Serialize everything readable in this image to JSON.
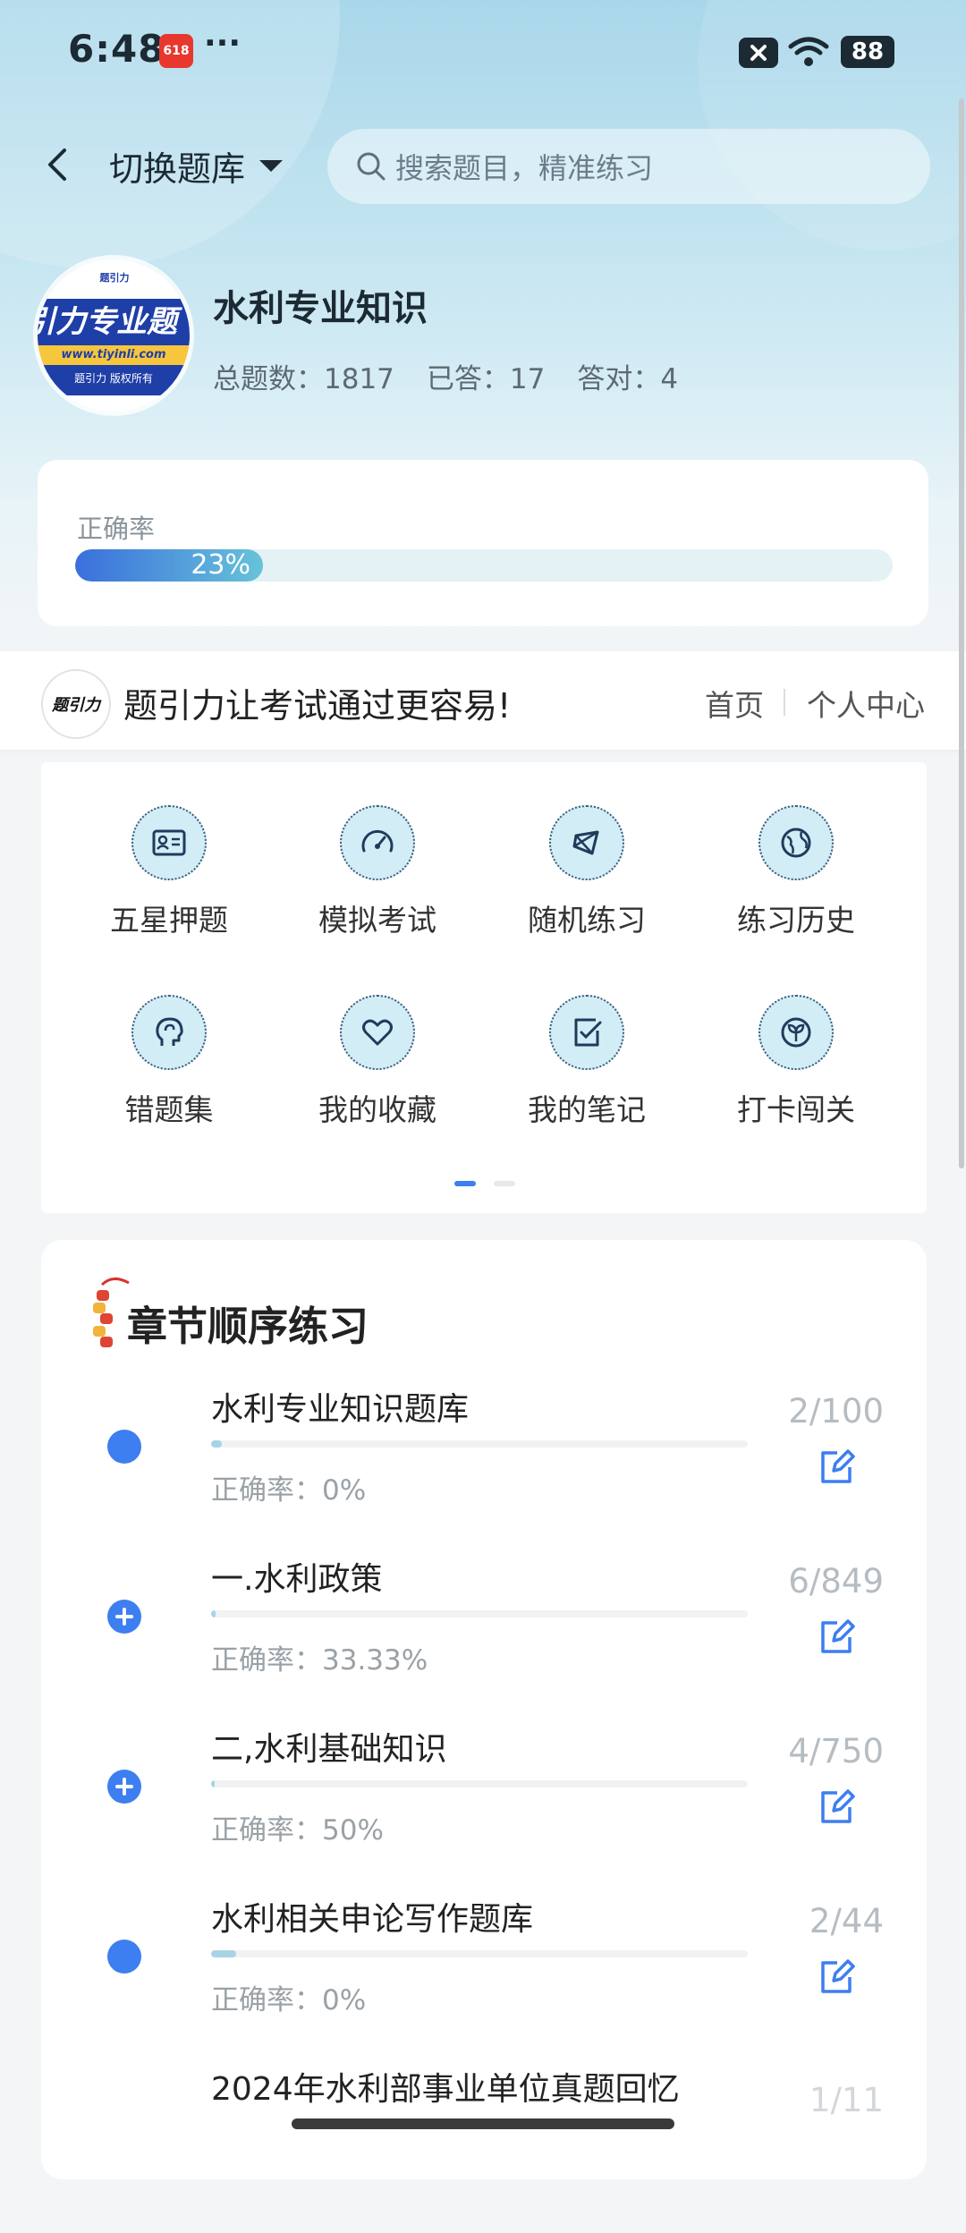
{
  "status_bar": {
    "time": "6:48",
    "app_badge": "618",
    "more": "···",
    "battery": "88"
  },
  "header": {
    "switch_label": "切换题库",
    "search_placeholder": "搜索题目，精准练习"
  },
  "bank": {
    "logo_title": "引力专业题",
    "logo_url": "www.tiyinli.com",
    "logo_footer": "题引力 版权所有",
    "logo_mini": "题引力",
    "title": "水利专业知识",
    "stats": [
      {
        "label": "总题数：",
        "value": "1817"
      },
      {
        "label": "已答：",
        "value": "17"
      },
      {
        "label": "答对：",
        "value": "4"
      }
    ]
  },
  "accuracy": {
    "label": "正确率",
    "value_text": "23%",
    "fraction": 0.23
  },
  "banner": {
    "logo_text": "题引力",
    "slogan": "题引力让考试通过更容易!",
    "home": "首页",
    "me": "个人中心"
  },
  "features": [
    {
      "label": "五星押题",
      "icon": "id-card-icon"
    },
    {
      "label": "模拟考试",
      "icon": "speedometer-icon"
    },
    {
      "label": "随机练习",
      "icon": "shuffle-icon"
    },
    {
      "label": "练习历史",
      "icon": "globe-history-icon"
    },
    {
      "label": "错题集",
      "icon": "brain-head-icon"
    },
    {
      "label": "我的收藏",
      "icon": "heart-icon"
    },
    {
      "label": "我的笔记",
      "icon": "note-check-icon"
    },
    {
      "label": "打卡闯关",
      "icon": "leaf-shield-icon"
    }
  ],
  "pager": {
    "pages": 2,
    "active": 0
  },
  "chapters": {
    "title": "章节顺序练习",
    "rows": [
      {
        "name": "水利专业知识题库",
        "accuracy_label": "正确率：",
        "accuracy": "0%",
        "count": "2/100",
        "expandable": false,
        "progress": 0.02
      },
      {
        "name": "一.水利政策",
        "accuracy_label": "正确率：",
        "accuracy": "33.33%",
        "count": "6/849",
        "expandable": true,
        "progress": 0.007
      },
      {
        "name": "二,水利基础知识",
        "accuracy_label": "正确率：",
        "accuracy": "50%",
        "count": "4/750",
        "expandable": true,
        "progress": 0.005
      },
      {
        "name": "水利相关申论写作题库",
        "accuracy_label": "正确率：",
        "accuracy": "0%",
        "count": "2/44",
        "expandable": false,
        "progress": 0.045
      },
      {
        "name": "2024年水利部事业单位真题回忆",
        "accuracy_label": "",
        "accuracy": "",
        "count": "1/11",
        "expandable": false,
        "progress": 0.09
      }
    ]
  },
  "colors": {
    "accent": "#3d7ef0",
    "icon_bg": "#d3edf6",
    "hero": "#a9d7ea"
  }
}
